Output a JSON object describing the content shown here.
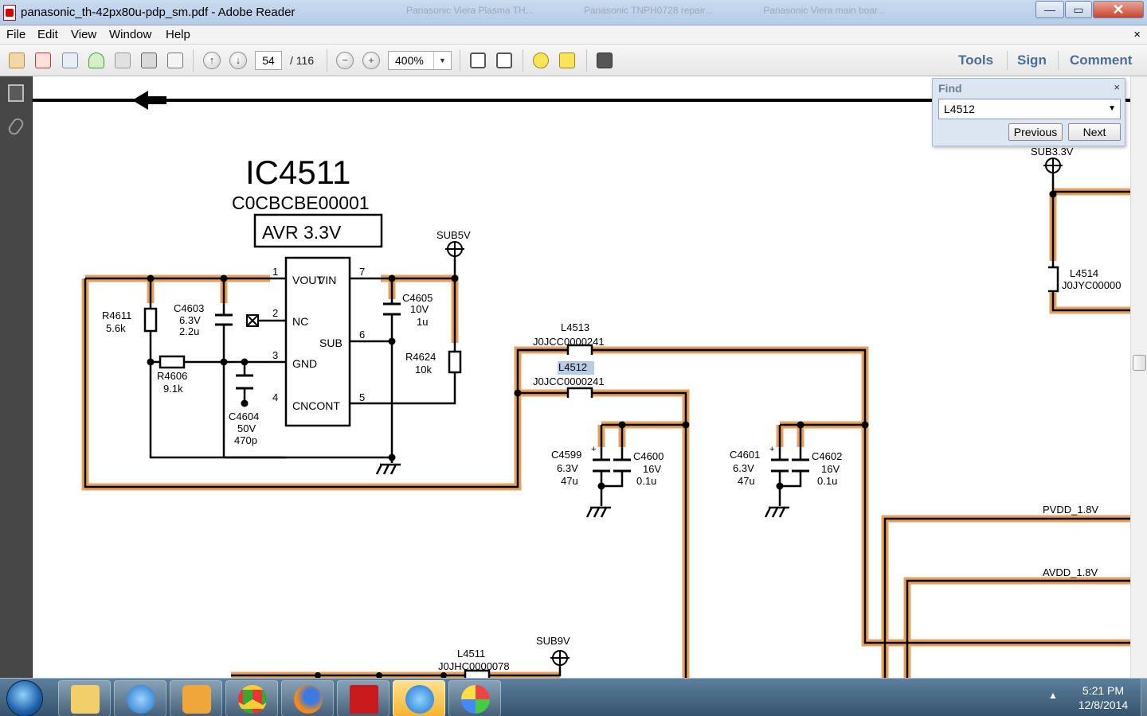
{
  "window": {
    "title": "panasonic_th-42px80u-pdp_sm.pdf - Adobe Reader",
    "ghost_tabs": [
      "Panasonic Viera Plasma TH...",
      "Panasonic TNPH0728 repair...",
      "Panasonic Viera main boar..."
    ],
    "controls": {
      "minimize": "—",
      "maximize": "▭",
      "close": "✕"
    }
  },
  "menu": {
    "items": [
      "File",
      "Edit",
      "View",
      "Window",
      "Help"
    ],
    "close": "×"
  },
  "toolbar": {
    "page_current": "54",
    "page_total": "/ 116",
    "zoom": "400%",
    "zoom_dropdown": "▼",
    "prev_page": "↑",
    "next_page": "↓",
    "zoom_out": "−",
    "zoom_in": "+",
    "tools": "Tools",
    "sign": "Sign",
    "comment": "Comment"
  },
  "find": {
    "title": "Find",
    "close": "×",
    "query": "L4512",
    "dropdown": "▼",
    "previous": "Previous",
    "next": "Next"
  },
  "schematic": {
    "ic_name": "IC4511",
    "ic_part": "C0CBCBE00001",
    "ic_func": "AVR 3.3V",
    "pins": {
      "vout": "VOUT",
      "vin": "VIN",
      "nc": "NC",
      "gnd": "GND",
      "sub": "SUB",
      "cncont": "CNCONT"
    },
    "pin_numbers": [
      "1",
      "2",
      "3",
      "4",
      "7",
      "6",
      "5"
    ],
    "sub5v": "SUB5V",
    "sub3v3": "SUB3.3V",
    "sub9v": "SUB9V",
    "pvdd": "PVDD_1.8V",
    "avdd": "AVDD_1.8V",
    "r4611": {
      "name": "R4611",
      "value": "5.6k"
    },
    "r4606": {
      "name": "R4606",
      "value": "9.1k"
    },
    "r4624": {
      "name": "R4624",
      "value": "10k"
    },
    "c4603": {
      "name": "C4603",
      "v": "6.3V",
      "value": "2.2u"
    },
    "c4604": {
      "name": "C4604",
      "v": "50V",
      "value": "470p"
    },
    "c4605": {
      "name": "C4605",
      "v": "10V",
      "value": "1u"
    },
    "l4513": {
      "name": "L4513",
      "part": "J0JCC0000241"
    },
    "l4512": {
      "name": "L4512",
      "part": "J0JCC0000241"
    },
    "l4514": {
      "name": "L4514",
      "part": "J0JYC00000"
    },
    "l4511": {
      "name": "L4511",
      "part": "J0JHC0000078"
    },
    "c4599": {
      "name": "C4599",
      "v": "6.3V",
      "value": "47u"
    },
    "c4600": {
      "name": "C4600",
      "v": "16V",
      "value": "0.1u"
    },
    "c4601": {
      "name": "C4601",
      "v": "6.3V",
      "value": "47u"
    },
    "c4602": {
      "name": "C4602",
      "v": "16V",
      "value": "0.1u"
    },
    "plus": "+"
  },
  "taskbar": {
    "time": "5:21 PM",
    "date": "12/8/2014",
    "tray_arrow": "▲",
    "apps": [
      "explorer",
      "internet-explorer",
      "media-player",
      "chrome",
      "firefox",
      "adobe-reader",
      "itunes",
      "paint"
    ]
  },
  "colors": {
    "trace": "#e8a15c",
    "wire": "#000000",
    "highlight": "#b8cbe6",
    "tb_right": "#4a6e96"
  }
}
